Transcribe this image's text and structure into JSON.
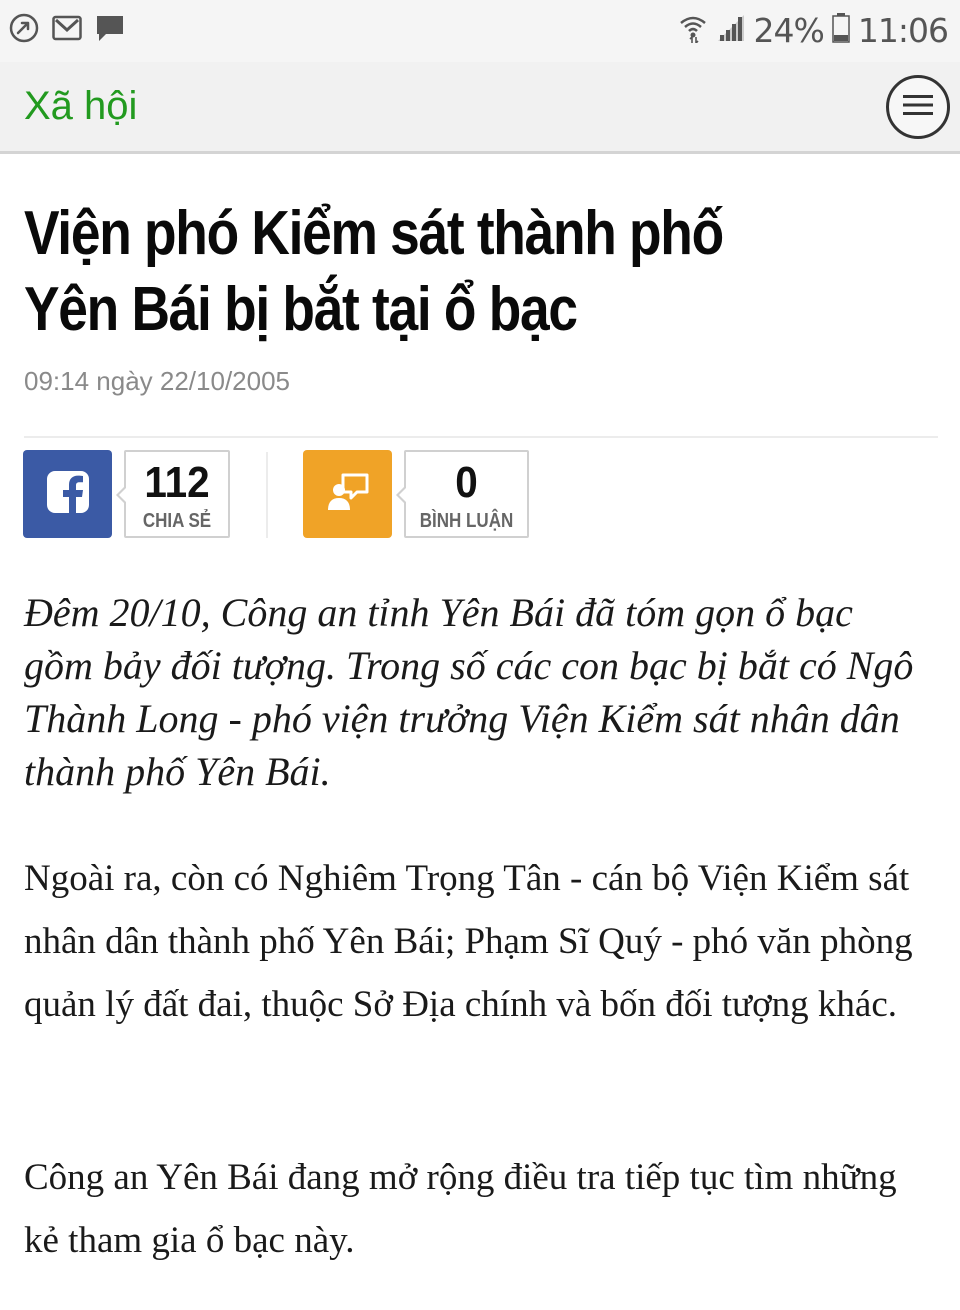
{
  "status_bar": {
    "battery": "24%",
    "time": "11:06"
  },
  "header": {
    "section": "Xã hội"
  },
  "article": {
    "title": "Viện phó Kiểm sát thành phố Yên Bái bị bắt tại ổ bạc",
    "timestamp": "09:14 ngày 22/10/2005",
    "lead": "Đêm 20/10, Công an tỉnh Yên Bái đã tóm gọn ổ bạc gồm bảy đối tượng. Trong số các con bạc bị bắt có Ngô Thành Long - phó viện trưởng Viện Kiểm sát nhân dân thành phố Yên Bái.",
    "paragraphs": [
      "Ngoài ra, còn có Nghiêm Trọng Tân - cán bộ Viện Kiểm sát nhân dân thành phố Yên Bái; Phạm Sĩ Quý - phó văn phòng quản lý đất đai, thuộc Sở Địa chính và bốn đối tượng khác.",
      "Công an Yên Bái đang mở rộng điều tra tiếp tục tìm những kẻ tham gia ổ bạc này."
    ]
  },
  "social": {
    "share_count": "112",
    "share_label": "CHIA SẺ",
    "comment_count": "0",
    "comment_label": "BÌNH LUẬN",
    "facebook_color": "#3b5aa5",
    "comment_color": "#f0a327"
  },
  "icons": {
    "status_left": [
      "call-forward-icon",
      "gmail-icon",
      "message-icon"
    ],
    "status_right": [
      "wifi-icon",
      "signal-icon",
      "battery-icon"
    ],
    "menu": "hamburger-menu-icon"
  },
  "colors": {
    "section_title": "#229a1f"
  }
}
